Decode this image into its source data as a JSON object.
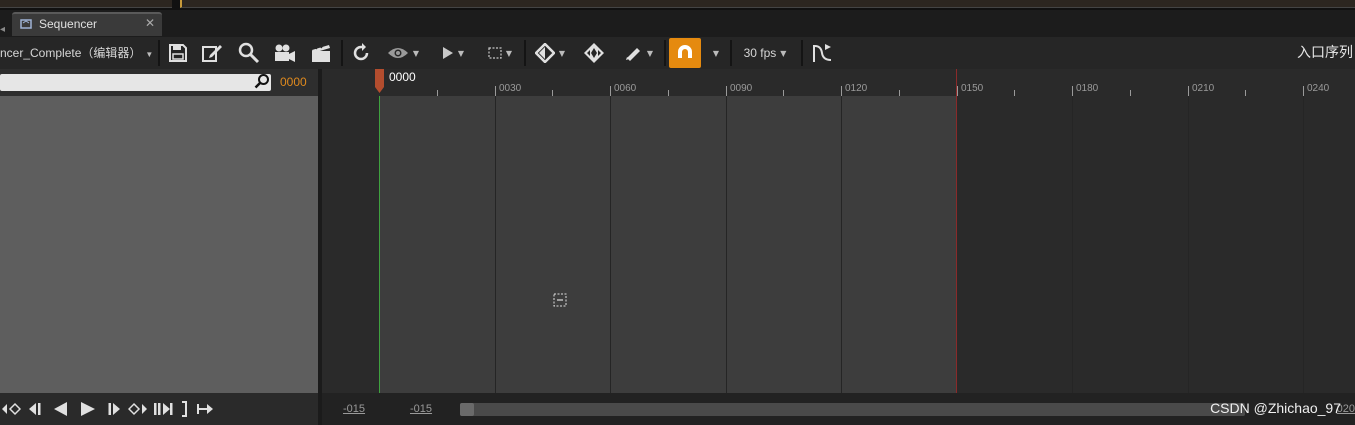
{
  "tab": {
    "title": "Sequencer",
    "close": "✕"
  },
  "toolbar": {
    "sequence_name": "ncer_Complete（编辑器）",
    "fps_label": "30 fps",
    "entry_label": "入口序列"
  },
  "search": {
    "frame": "0000"
  },
  "timeline": {
    "current_frame": "0000",
    "tick_labels": [
      "0030",
      "0060",
      "0090",
      "0120",
      "0150",
      "0180",
      "0210",
      "0240"
    ]
  },
  "bottom": {
    "range_start": "-015",
    "range_start2": "-015",
    "range_end": "020"
  },
  "watermark": "CSDN @Zhichao_97",
  "colors": {
    "accent": "#e58a0f",
    "start_marker": "#3fa23f",
    "end_marker": "#8a2a2a",
    "playhead": "#b34d2e"
  }
}
